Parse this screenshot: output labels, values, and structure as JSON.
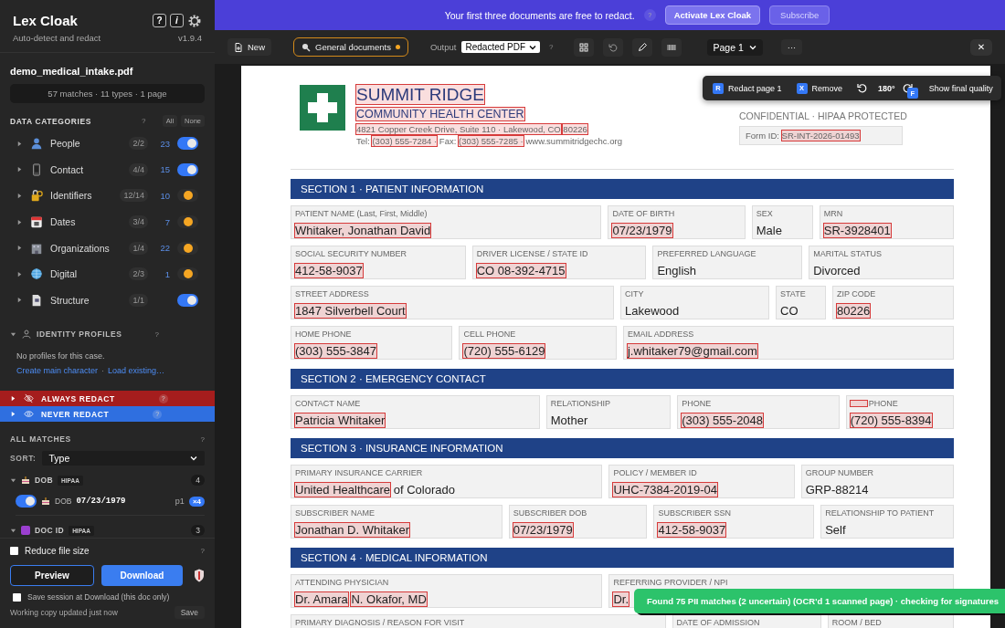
{
  "sidebar": {
    "title": "Lex Cloak",
    "subtitle": "Auto-detect and redact",
    "help_button": "?",
    "info_button": "i",
    "version": "v1.9.4",
    "file_name": "demo_medical_intake.pdf",
    "stats": "57 matches · 11 types · 1 page",
    "categories_header": {
      "title": "DATA CATEGORIES",
      "help": "?",
      "all": "All",
      "none": "None"
    },
    "categories": [
      {
        "name": "People",
        "ratio": "2/2",
        "count": "23",
        "on": true
      },
      {
        "name": "Contact",
        "ratio": "4/4",
        "count": "15",
        "on": true
      },
      {
        "name": "Identifiers",
        "ratio": "12/14",
        "count": "10",
        "on": false
      },
      {
        "name": "Dates",
        "ratio": "3/4",
        "count": "7",
        "on": false
      },
      {
        "name": "Organizations",
        "ratio": "1/4",
        "count": "22",
        "on": false
      },
      {
        "name": "Digital",
        "ratio": "2/3",
        "count": "1",
        "on": false
      },
      {
        "name": "Structure",
        "ratio": "1/1",
        "on": true
      }
    ],
    "identity_profiles": {
      "title": "IDENTITY PROFILES",
      "help": "?",
      "expanded": true,
      "empty_text": "No profiles for this case.",
      "links": [
        "Create main character",
        "Load existing…"
      ],
      "separator": "·"
    },
    "always_redact": {
      "title": "ALWAYS REDACT",
      "help": "?",
      "expanded": false
    },
    "never_redact": {
      "title": "NEVER REDACT",
      "help": "?",
      "expanded": false
    },
    "all_matches": {
      "title": "ALL MATCHES",
      "help": "?",
      "sort_label": "SORT:",
      "sort_value": "Type",
      "groups": [
        {
          "name": "DOB",
          "tag": "HIPAA",
          "count": "4",
          "expanded": true,
          "items": [
            {
              "on": true,
              "type": "DOB",
              "value": "07/23/1979",
              "page": "p1",
              "multiplier": "×4"
            }
          ]
        },
        {
          "name": "DOC ID",
          "tag": "HIPAA",
          "count": "3",
          "expanded": true
        }
      ]
    },
    "reduce_file_size": {
      "label": "Reduce file size",
      "checked": false,
      "help": "?"
    },
    "preview": "Preview",
    "download": "Download",
    "save_session": {
      "label": "Save session at Download (this doc only)",
      "checked": false
    },
    "status": "Working copy updated just now",
    "save": "Save"
  },
  "banner": {
    "message": "Your first three documents are free to redact.",
    "help": "?",
    "activate": "Activate Lex Cloak",
    "subscribe": "Subscribe"
  },
  "toolbar": {
    "new": "New",
    "profile": "General documents",
    "profile_dirty": true,
    "output_label": "Output",
    "output_value": "Redacted PDF",
    "help": "?",
    "page_value": "Page 1",
    "more": "···",
    "close": "✕"
  },
  "document": {
    "header": {
      "org_name": [
        {
          "text": "SUMMIT RIDGE",
          "redacted": true
        }
      ],
      "org_subtitle": [
        {
          "text": "COMMUNITY HEALTH CENTER",
          "redacted": true
        }
      ],
      "address": [
        {
          "text": "4821 Copper Creek Drive, Suite 110 · Lakewood, CO",
          "redacted": true
        },
        {
          "text": "80226",
          "redacted": true
        }
      ],
      "contact": [
        {
          "text": "Tel:",
          "redacted": false
        },
        {
          "text": "(303) 555-7284 ·",
          "redacted": true
        },
        {
          "text": "Fax:",
          "redacted": false
        },
        {
          "text": "(303) 555-7285 ·",
          "redacted": true
        },
        {
          "text": "www.summitridgechc.org",
          "redacted": false
        }
      ],
      "confidential": "CONFIDENTIAL · HIPAA PROTECTED",
      "form_id": [
        {
          "text": "Form ID:",
          "redacted": false
        },
        {
          "text": "SR-INT-2026-01493",
          "redacted": true
        }
      ]
    },
    "sections": [
      {
        "title": "SECTION 1 · PATIENT INFORMATION",
        "rows": [
          {
            "fields": [
              {
                "label": "PATIENT NAME (Last, First, Middle)",
                "value": [
                  {
                    "text": "Whitaker, Jonathan David",
                    "redacted": true
                  }
                ]
              },
              {
                "label": "DATE OF BIRTH",
                "value": [
                  {
                    "text": "07/23/1979",
                    "redacted": true
                  }
                ]
              },
              {
                "label": "SEX",
                "value": [
                  {
                    "text": "Male",
                    "redacted": false
                  }
                ]
              },
              {
                "label": "MRN",
                "value": [
                  {
                    "text": "SR-3928401",
                    "redacted": true
                  }
                ]
              }
            ]
          },
          {
            "fields": [
              {
                "label": "SOCIAL SECURITY NUMBER",
                "value": [
                  {
                    "text": "412-58-9037",
                    "redacted": true
                  }
                ]
              },
              {
                "label": "DRIVER LICENSE / STATE ID",
                "value": [
                  {
                    "text": "CO 08-392-4715",
                    "redacted": true
                  }
                ]
              },
              {
                "label": "PREFERRED LANGUAGE",
                "value": [
                  {
                    "text": "English",
                    "redacted": false
                  }
                ]
              },
              {
                "label": "MARITAL STATUS",
                "value": [
                  {
                    "text": "Divorced",
                    "redacted": false
                  }
                ]
              }
            ]
          },
          {
            "fields": [
              {
                "label": "STREET ADDRESS",
                "value": [
                  {
                    "text": "1847 Silverbell Court",
                    "redacted": true
                  }
                ]
              },
              {
                "label": "CITY",
                "value": [
                  {
                    "text": "Lakewood",
                    "redacted": false
                  }
                ]
              },
              {
                "label": "STATE",
                "value": [
                  {
                    "text": "CO",
                    "redacted": false
                  }
                ]
              },
              {
                "label": "ZIP CODE",
                "value": [
                  {
                    "text": "80226",
                    "redacted": true
                  }
                ]
              }
            ]
          },
          {
            "fields": [
              {
                "label": "HOME PHONE",
                "value": [
                  {
                    "text": "(303) 555-3847",
                    "redacted": true
                  }
                ]
              },
              {
                "label": "CELL PHONE",
                "value": [
                  {
                    "text": "(720) 555-6129",
                    "redacted": true
                  }
                ]
              },
              {
                "label": "EMAIL ADDRESS",
                "value": [
                  {
                    "text": "j.whitaker79@gmail.com",
                    "redacted": true
                  }
                ]
              }
            ]
          }
        ]
      },
      {
        "title": "SECTION 2 · EMERGENCY CONTACT",
        "rows": [
          {
            "fields": [
              {
                "label": "CONTACT NAME",
                "value": [
                  {
                    "text": "Patricia Whitaker",
                    "redacted": true
                  }
                ]
              },
              {
                "label": "RELATIONSHIP",
                "value": [
                  {
                    "text": "Mother",
                    "redacted": false
                  }
                ]
              },
              {
                "label": "PHONE",
                "value": [
                  {
                    "text": "(303) 555-2048",
                    "redacted": true
                  }
                ]
              },
              {
                "label": "PHONE",
                "label_prefix_redacted": true,
                "value": [
                  {
                    "text": "(720) 555-8394",
                    "redacted": true
                  }
                ]
              }
            ]
          }
        ]
      },
      {
        "title": "SECTION 3 · INSURANCE INFORMATION",
        "rows": [
          {
            "fields": [
              {
                "label": "PRIMARY INSURANCE CARRIER",
                "value": [
                  {
                    "text": "United Healthcare",
                    "redacted": true
                  },
                  {
                    "text": "of Colorado",
                    "redacted": false
                  }
                ]
              },
              {
                "label": "POLICY / MEMBER ID",
                "value": [
                  {
                    "text": "UHC-7384-2019-04",
                    "redacted": true
                  }
                ]
              },
              {
                "label": "GROUP NUMBER",
                "value": [
                  {
                    "text": "GRP-88214",
                    "redacted": false
                  }
                ]
              }
            ]
          },
          {
            "fields": [
              {
                "label": "SUBSCRIBER NAME",
                "value": [
                  {
                    "text": "Jonathan D. Whitaker",
                    "redacted": true
                  }
                ]
              },
              {
                "label": "SUBSCRIBER DOB",
                "value": [
                  {
                    "text": "07/23/1979",
                    "redacted": true
                  }
                ]
              },
              {
                "label": "SUBSCRIBER SSN",
                "value": [
                  {
                    "text": "412-58-9037",
                    "redacted": true
                  }
                ]
              },
              {
                "label": "RELATIONSHIP TO PATIENT",
                "value": [
                  {
                    "text": "Self",
                    "redacted": false
                  }
                ]
              }
            ]
          }
        ]
      },
      {
        "title": "SECTION 4 · MEDICAL INFORMATION",
        "rows": [
          {
            "fields": [
              {
                "label": "ATTENDING PHYSICIAN",
                "value": [
                  {
                    "text": "Dr. Amara",
                    "redacted": true
                  },
                  {
                    "text": "N. Okafor, MD",
                    "redacted": true
                  }
                ]
              },
              {
                "label": "REFERRING PROVIDER / NPI",
                "value": [
                  {
                    "text": "Dr.",
                    "redacted": true
                  }
                ]
              }
            ]
          },
          {
            "fields": [
              {
                "label": "PRIMARY DIAGNOSIS / REASON FOR VISIT"
              },
              {
                "label": "DATE OF ADMISSION"
              },
              {
                "label": "ROOM / BED"
              }
            ]
          }
        ]
      }
    ]
  },
  "page_toolbar": {
    "redact_key": "R",
    "redact": "Redact page 1",
    "remove_key": "X",
    "remove": "Remove",
    "rotation": "180°",
    "final_key": "F",
    "final": "Show final quality"
  },
  "toast": {
    "message": "Found 75 PII matches (2 uncertain) (OCR'd 1 scanned page) · checking for signatures"
  }
}
